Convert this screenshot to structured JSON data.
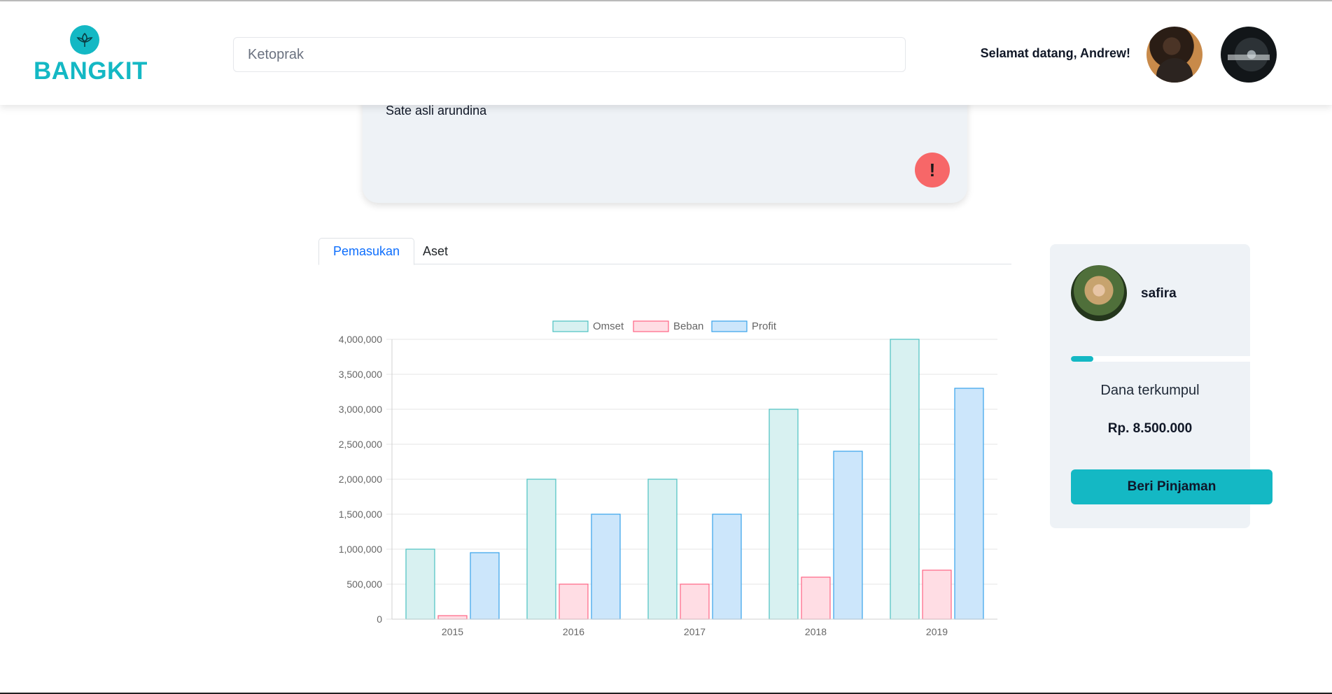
{
  "header": {
    "brand": "BANGKIT",
    "search_value": "Ketoprak",
    "welcome": "Selamat datang, Andrew!",
    "logo_icon": "leaf-icon"
  },
  "report": {
    "text": "Sate asli arundina",
    "alert_label": "!"
  },
  "tabs": [
    {
      "label": "Pemasukan",
      "active": true
    },
    {
      "label": "Aset",
      "active": false
    }
  ],
  "loan": {
    "borrower": "safira",
    "progress": 0.11,
    "raised_label": "Dana terkumpul",
    "raised_amount": "Rp. 8.500.000",
    "button": "Beri Pinjaman"
  },
  "colors": {
    "brand": "#14b8c4",
    "alert": "#f76768",
    "omset_fill": "#d8f1f1",
    "omset_stroke": "#4bc0c0",
    "beban_fill": "#ffdde4",
    "beban_stroke": "#ff6384",
    "profit_fill": "#cce6fb",
    "profit_stroke": "#36a2eb"
  },
  "chart_data": {
    "type": "bar",
    "categories": [
      "2015",
      "2016",
      "2017",
      "2018",
      "2019"
    ],
    "series": [
      {
        "name": "Omset",
        "values": [
          1000000,
          2000000,
          2000000,
          3000000,
          4000000
        ]
      },
      {
        "name": "Beban",
        "values": [
          50000,
          500000,
          500000,
          600000,
          700000
        ]
      },
      {
        "name": "Profit",
        "values": [
          950000,
          1500000,
          1500000,
          2400000,
          3300000
        ]
      }
    ],
    "yticks": [
      "0",
      "500,000",
      "1,000,000",
      "1,500,000",
      "2,000,000",
      "2,500,000",
      "3,000,000",
      "3,500,000",
      "4,000,000"
    ],
    "ylim": [
      0,
      4000000
    ],
    "legend": "top-center",
    "grid": true
  }
}
